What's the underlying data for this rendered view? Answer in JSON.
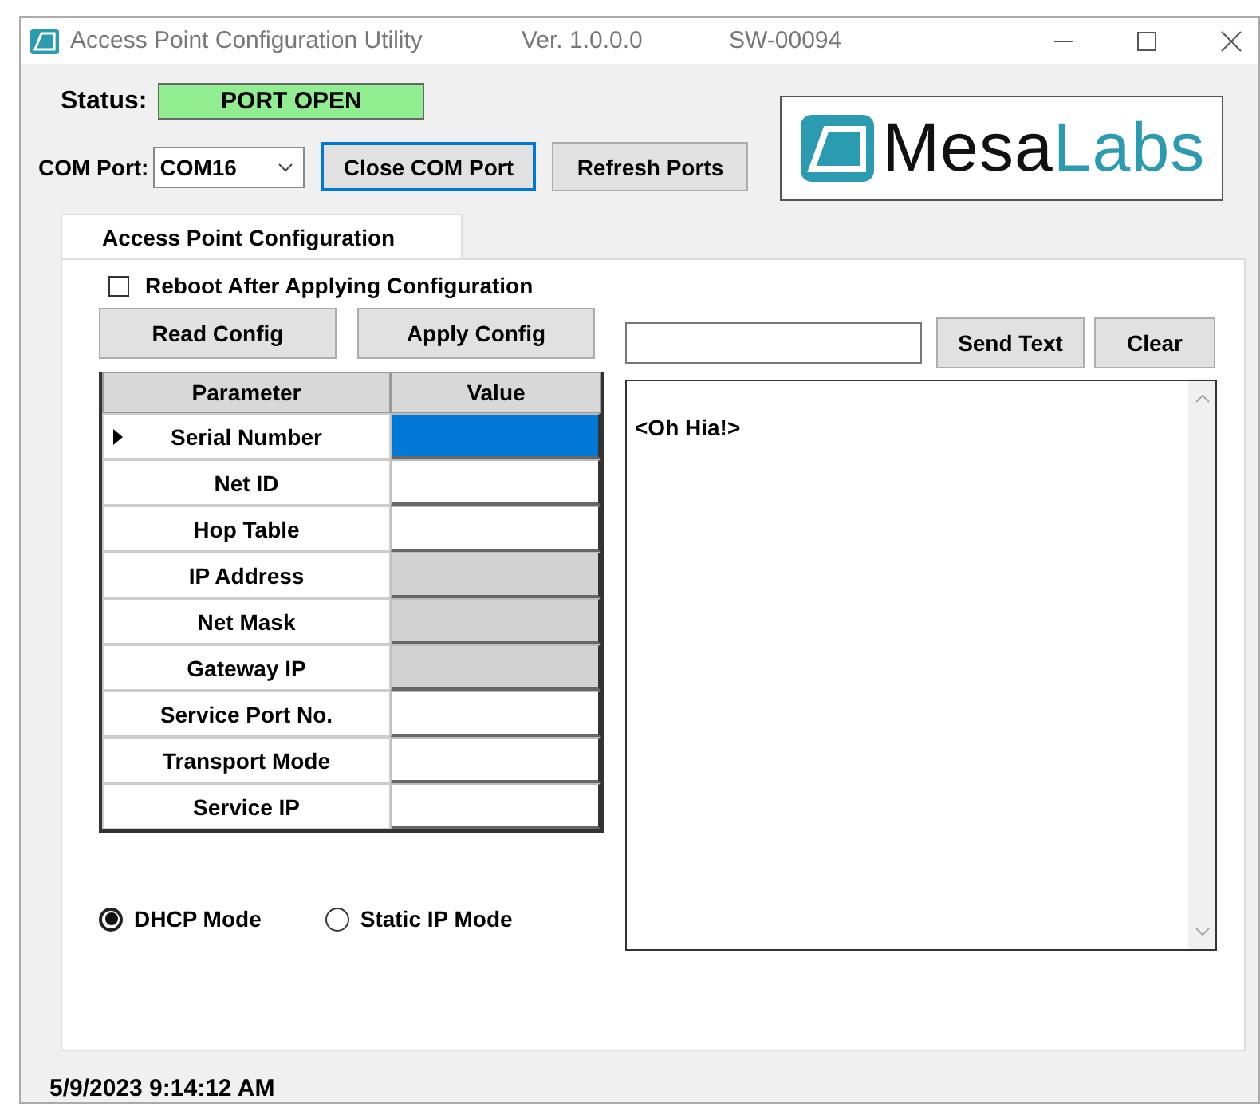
{
  "window": {
    "title": "Access Point Configuration Utility",
    "version": "Ver. 1.0.0.0",
    "code": "SW-00094"
  },
  "status": {
    "label": "Status:",
    "value": "PORT OPEN",
    "color": "#90ee90"
  },
  "com_port": {
    "label": "COM Port:",
    "value": "COM16"
  },
  "buttons": [
    {
      "label": "Close COM Port",
      "focused": true
    },
    {
      "label": "Refresh Ports",
      "focused": false
    }
  ],
  "logo": {
    "words": [
      "Mesa",
      "Labs"
    ]
  },
  "tabs": [
    {
      "label": "Access Point Configuration",
      "selected": true
    }
  ],
  "reboot": {
    "label": "Reboot After Applying Configuration",
    "checked": false
  },
  "config_buttons": [
    "Read Config",
    "Apply Config"
  ],
  "send": {
    "button": "Send Text",
    "clear": "Clear"
  },
  "table": {
    "columns": [
      "Parameter",
      "Value"
    ],
    "rows": [
      {
        "parameter": "Serial Number",
        "current": true,
        "selected": true,
        "disabled": false
      },
      {
        "parameter": "Net ID",
        "current": false,
        "selected": false,
        "disabled": false
      },
      {
        "parameter": "Hop Table",
        "current": false,
        "selected": false,
        "disabled": false
      },
      {
        "parameter": "IP Address",
        "current": false,
        "selected": false,
        "disabled": true
      },
      {
        "parameter": "Net Mask",
        "current": false,
        "selected": false,
        "disabled": true
      },
      {
        "parameter": "Gateway IP",
        "current": false,
        "selected": false,
        "disabled": true
      },
      {
        "parameter": "Service Port No.",
        "current": false,
        "selected": false,
        "disabled": false
      },
      {
        "parameter": "Transport Mode",
        "current": false,
        "selected": false,
        "disabled": false
      },
      {
        "parameter": "Service IP",
        "current": false,
        "selected": false,
        "disabled": false
      }
    ]
  },
  "log": {
    "text": "<Oh Hia!>"
  },
  "modes": [
    {
      "label": "DHCP Mode",
      "selected": true
    },
    {
      "label": "Static IP Mode",
      "selected": false
    }
  ],
  "status_bar": {
    "datetime": "5/9/2023 9:14:12 AM"
  }
}
